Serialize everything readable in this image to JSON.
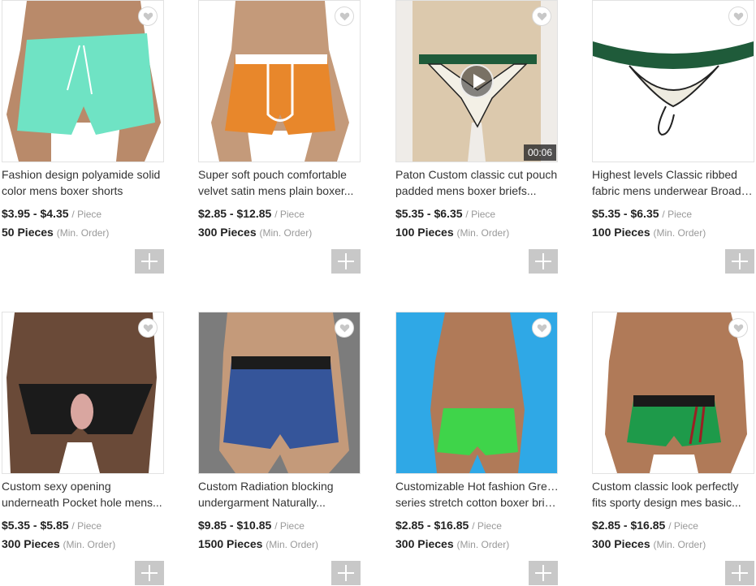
{
  "products": [
    {
      "title_lines": [
        "Fashion design polyamide solid",
        "color mens boxer shorts"
      ],
      "price": "$3.95 - $4.35",
      "unit": "/ Piece",
      "moq": "50 Pieces",
      "moq_label": "(Min. Order)",
      "image": "mint-swim-shorts",
      "colors": {
        "bg": "#ffffff",
        "main": "#6fe3c4",
        "skin": "#b98a6a"
      },
      "video": null
    },
    {
      "title_lines": [
        "Super soft pouch comfortable",
        "velvet satin mens plain boxer..."
      ],
      "price": "$2.85 - $12.85",
      "unit": "/ Piece",
      "moq": "300 Pieces",
      "moq_label": "(Min. Order)",
      "image": "orange-boxer",
      "colors": {
        "bg": "#ffffff",
        "main": "#e8872b",
        "skin": "#c49a7a"
      },
      "video": null
    },
    {
      "title_lines": [
        "Paton Custom classic cut pouch",
        "padded mens boxer briefs..."
      ],
      "price": "$5.35 - $6.35",
      "unit": "/ Piece",
      "moq": "100 Pieces",
      "moq_label": "(Min. Order)",
      "image": "mannequin-jockstrap",
      "colors": {
        "bg": "#efece8",
        "main": "#1f5b3a",
        "skin": "#dcc9ad"
      },
      "video": "00:06"
    },
    {
      "title_lines": [
        "Highest levels Classic ribbed",
        "fabric mens underwear Broade..."
      ],
      "price": "$5.35 - $6.35",
      "unit": "/ Piece",
      "moq": "100 Pieces",
      "moq_label": "(Min. Order)",
      "image": "green-waistband-thong",
      "colors": {
        "bg": "#ffffff",
        "main": "#1f5b3a",
        "skin": "#eeeeea"
      },
      "video": null
    },
    {
      "title_lines": [
        "Custom sexy opening",
        "underneath Pocket hole mens..."
      ],
      "price": "$5.35 - $5.85",
      "unit": "/ Piece",
      "moq": "300 Pieces",
      "moq_label": "(Min. Order)",
      "image": "black-brief-opening",
      "colors": {
        "bg": "#ffffff",
        "main": "#1b1b1b",
        "skin": "#6a4a38"
      },
      "video": null
    },
    {
      "title_lines": [
        "Custom Radiation blocking",
        "undergarment Naturally..."
      ],
      "price": "$9.85 - $10.85",
      "unit": "/ Piece",
      "moq": "1500 Pieces",
      "moq_label": "(Min. Order)",
      "image": "blue-boxer-brief",
      "colors": {
        "bg": "#7c7c7c",
        "main": "#35559a",
        "skin": "#c49a7a"
      },
      "video": null
    },
    {
      "title_lines": [
        "Customizable Hot fashion Green",
        "series stretch cotton boxer brie..."
      ],
      "price": "$2.85 - $16.85",
      "unit": "/ Piece",
      "moq": "300 Pieces",
      "moq_label": "(Min. Order)",
      "image": "green-trunk-blue-bg",
      "colors": {
        "bg": "#2fa8e6",
        "main": "#3fd44a",
        "skin": "#b07a58"
      },
      "video": null
    },
    {
      "title_lines": [
        "Custom classic look perfectly",
        "fits sporty design mes basic..."
      ],
      "price": "$2.85 - $16.85",
      "unit": "/ Piece",
      "moq": "300 Pieces",
      "moq_label": "(Min. Order)",
      "image": "green-trunk-waistband",
      "colors": {
        "bg": "#ffffff",
        "main": "#1e9a4a",
        "skin": "#b07a58"
      },
      "video": null
    }
  ],
  "icons": {
    "favorite": "heart-icon",
    "add": "plus-icon",
    "video": "play-icon"
  }
}
